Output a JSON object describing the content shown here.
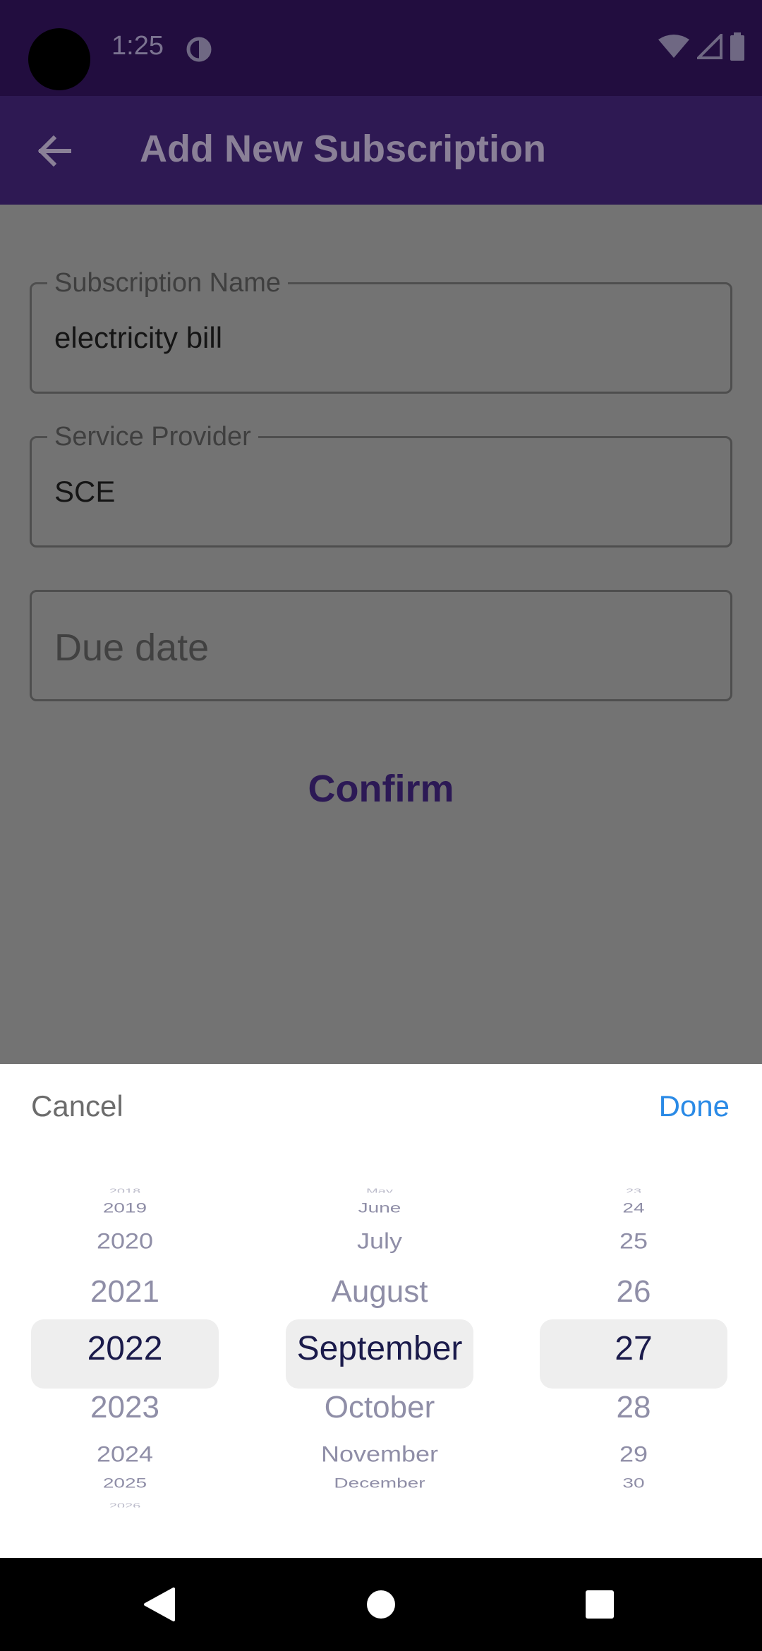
{
  "status_bar": {
    "time": "1:25"
  },
  "app_bar": {
    "title": "Add New Subscription",
    "back_icon": "arrow-left-icon"
  },
  "form": {
    "subscription_name": {
      "label": "Subscription Name",
      "value": "electricity bill"
    },
    "service_provider": {
      "label": "Service Provider",
      "value": "SCE"
    },
    "due_date": {
      "placeholder": "Due date"
    },
    "confirm_label": "Confirm"
  },
  "date_picker": {
    "cancel_label": "Cancel",
    "done_label": "Done",
    "years": {
      "tiny_top": "2018",
      "far_top": "2019",
      "mid_top": "2020",
      "near_top": "2021",
      "selected": "2022",
      "near_bottom": "2023",
      "mid_bottom": "2024",
      "far_bottom": "2025",
      "tiny_bottom": "2026"
    },
    "months": {
      "tiny_top": "May",
      "far_top": "June",
      "mid_top": "July",
      "near_top": "August",
      "selected": "September",
      "near_bottom": "October",
      "mid_bottom": "November",
      "far_bottom": "December",
      "tiny_bottom": ""
    },
    "days": {
      "tiny_top": "23",
      "far_top": "24",
      "mid_top": "25",
      "near_top": "26",
      "selected": "27",
      "near_bottom": "28",
      "mid_bottom": "29",
      "far_bottom": "30",
      "tiny_bottom": ""
    }
  },
  "colors": {
    "status_bar": "#220d3f",
    "app_bar": "#2e1953",
    "scrim_body": "#737373",
    "accent": "#2a8ae6",
    "confirm": "#2c1955"
  },
  "nav_bar": {
    "back_icon": "triangle-back-icon",
    "home_icon": "circle-home-icon",
    "recents_icon": "square-recents-icon"
  }
}
